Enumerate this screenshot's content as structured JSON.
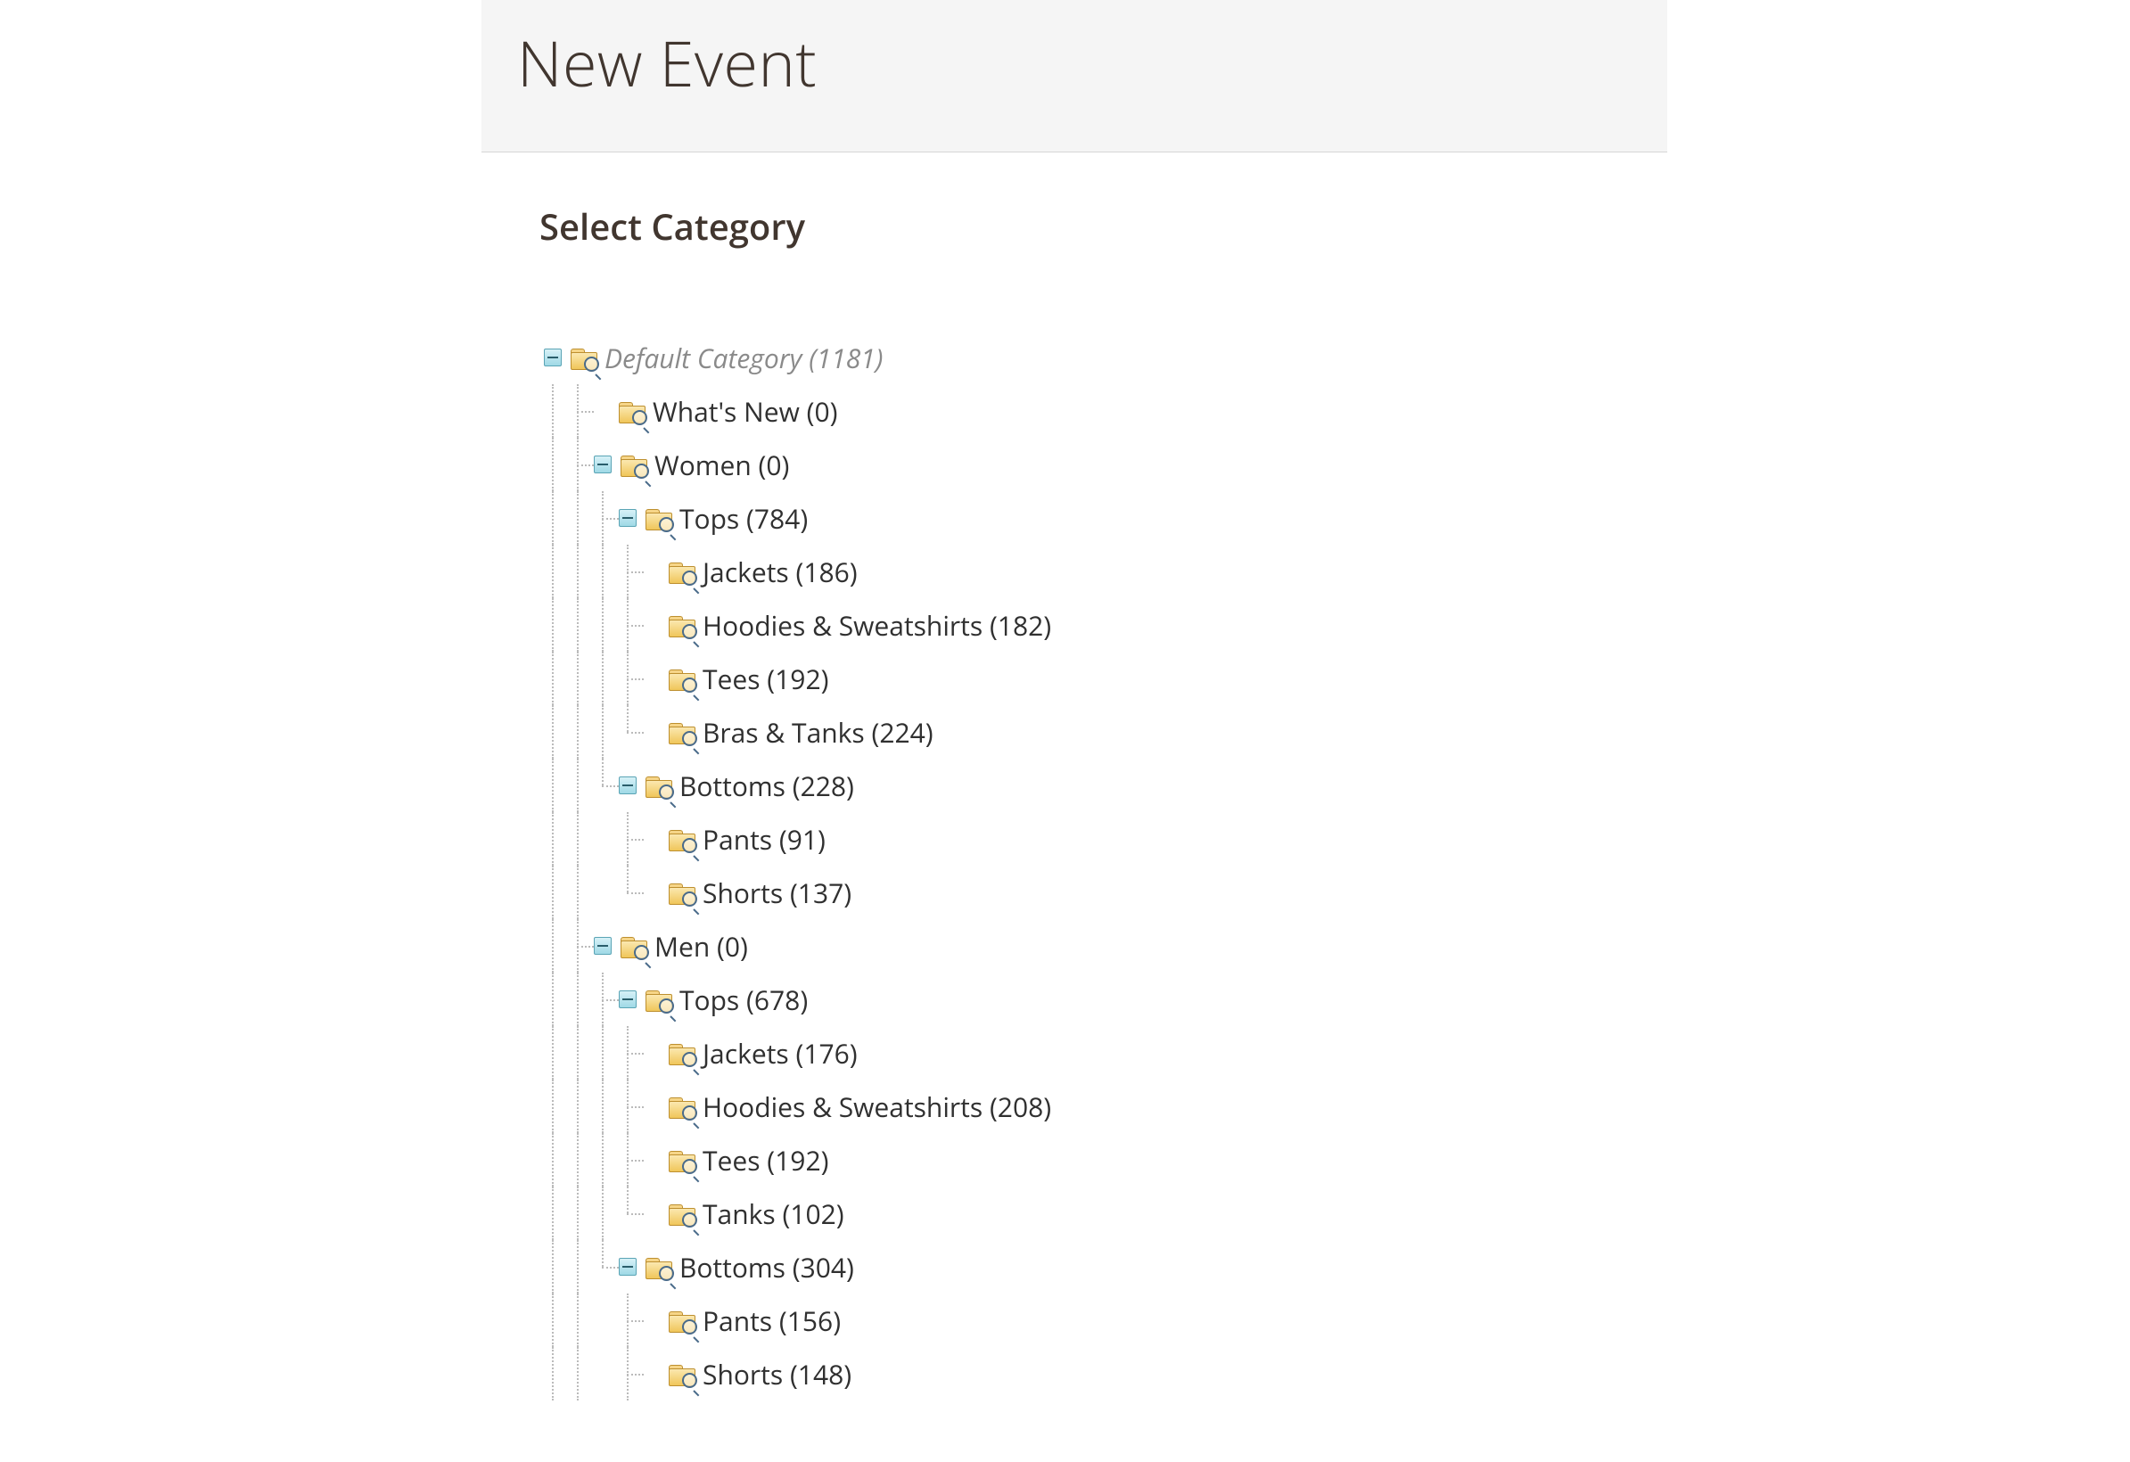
{
  "header": {
    "title": "New Event"
  },
  "section": {
    "title": "Select Category"
  },
  "tree": {
    "root": {
      "label": "Default Category (1181)",
      "children": {
        "whats_new": {
          "label": "What's New (0)"
        },
        "women": {
          "label": "Women (0)",
          "tops": {
            "label": "Tops (784)",
            "jackets": {
              "label": "Jackets (186)"
            },
            "hoodies": {
              "label": "Hoodies & Sweatshirts (182)"
            },
            "tees": {
              "label": "Tees (192)"
            },
            "bras": {
              "label": "Bras & Tanks (224)"
            }
          },
          "bottoms": {
            "label": "Bottoms (228)",
            "pants": {
              "label": "Pants (91)"
            },
            "shorts": {
              "label": "Shorts (137)"
            }
          }
        },
        "men": {
          "label": "Men (0)",
          "tops": {
            "label": "Tops (678)",
            "jackets": {
              "label": "Jackets (176)"
            },
            "hoodies": {
              "label": "Hoodies & Sweatshirts (208)"
            },
            "tees": {
              "label": "Tees (192)"
            },
            "tanks": {
              "label": "Tanks (102)"
            }
          },
          "bottoms": {
            "label": "Bottoms (304)",
            "pants": {
              "label": "Pants (156)"
            },
            "shorts": {
              "label": "Shorts (148)"
            }
          }
        }
      }
    }
  }
}
